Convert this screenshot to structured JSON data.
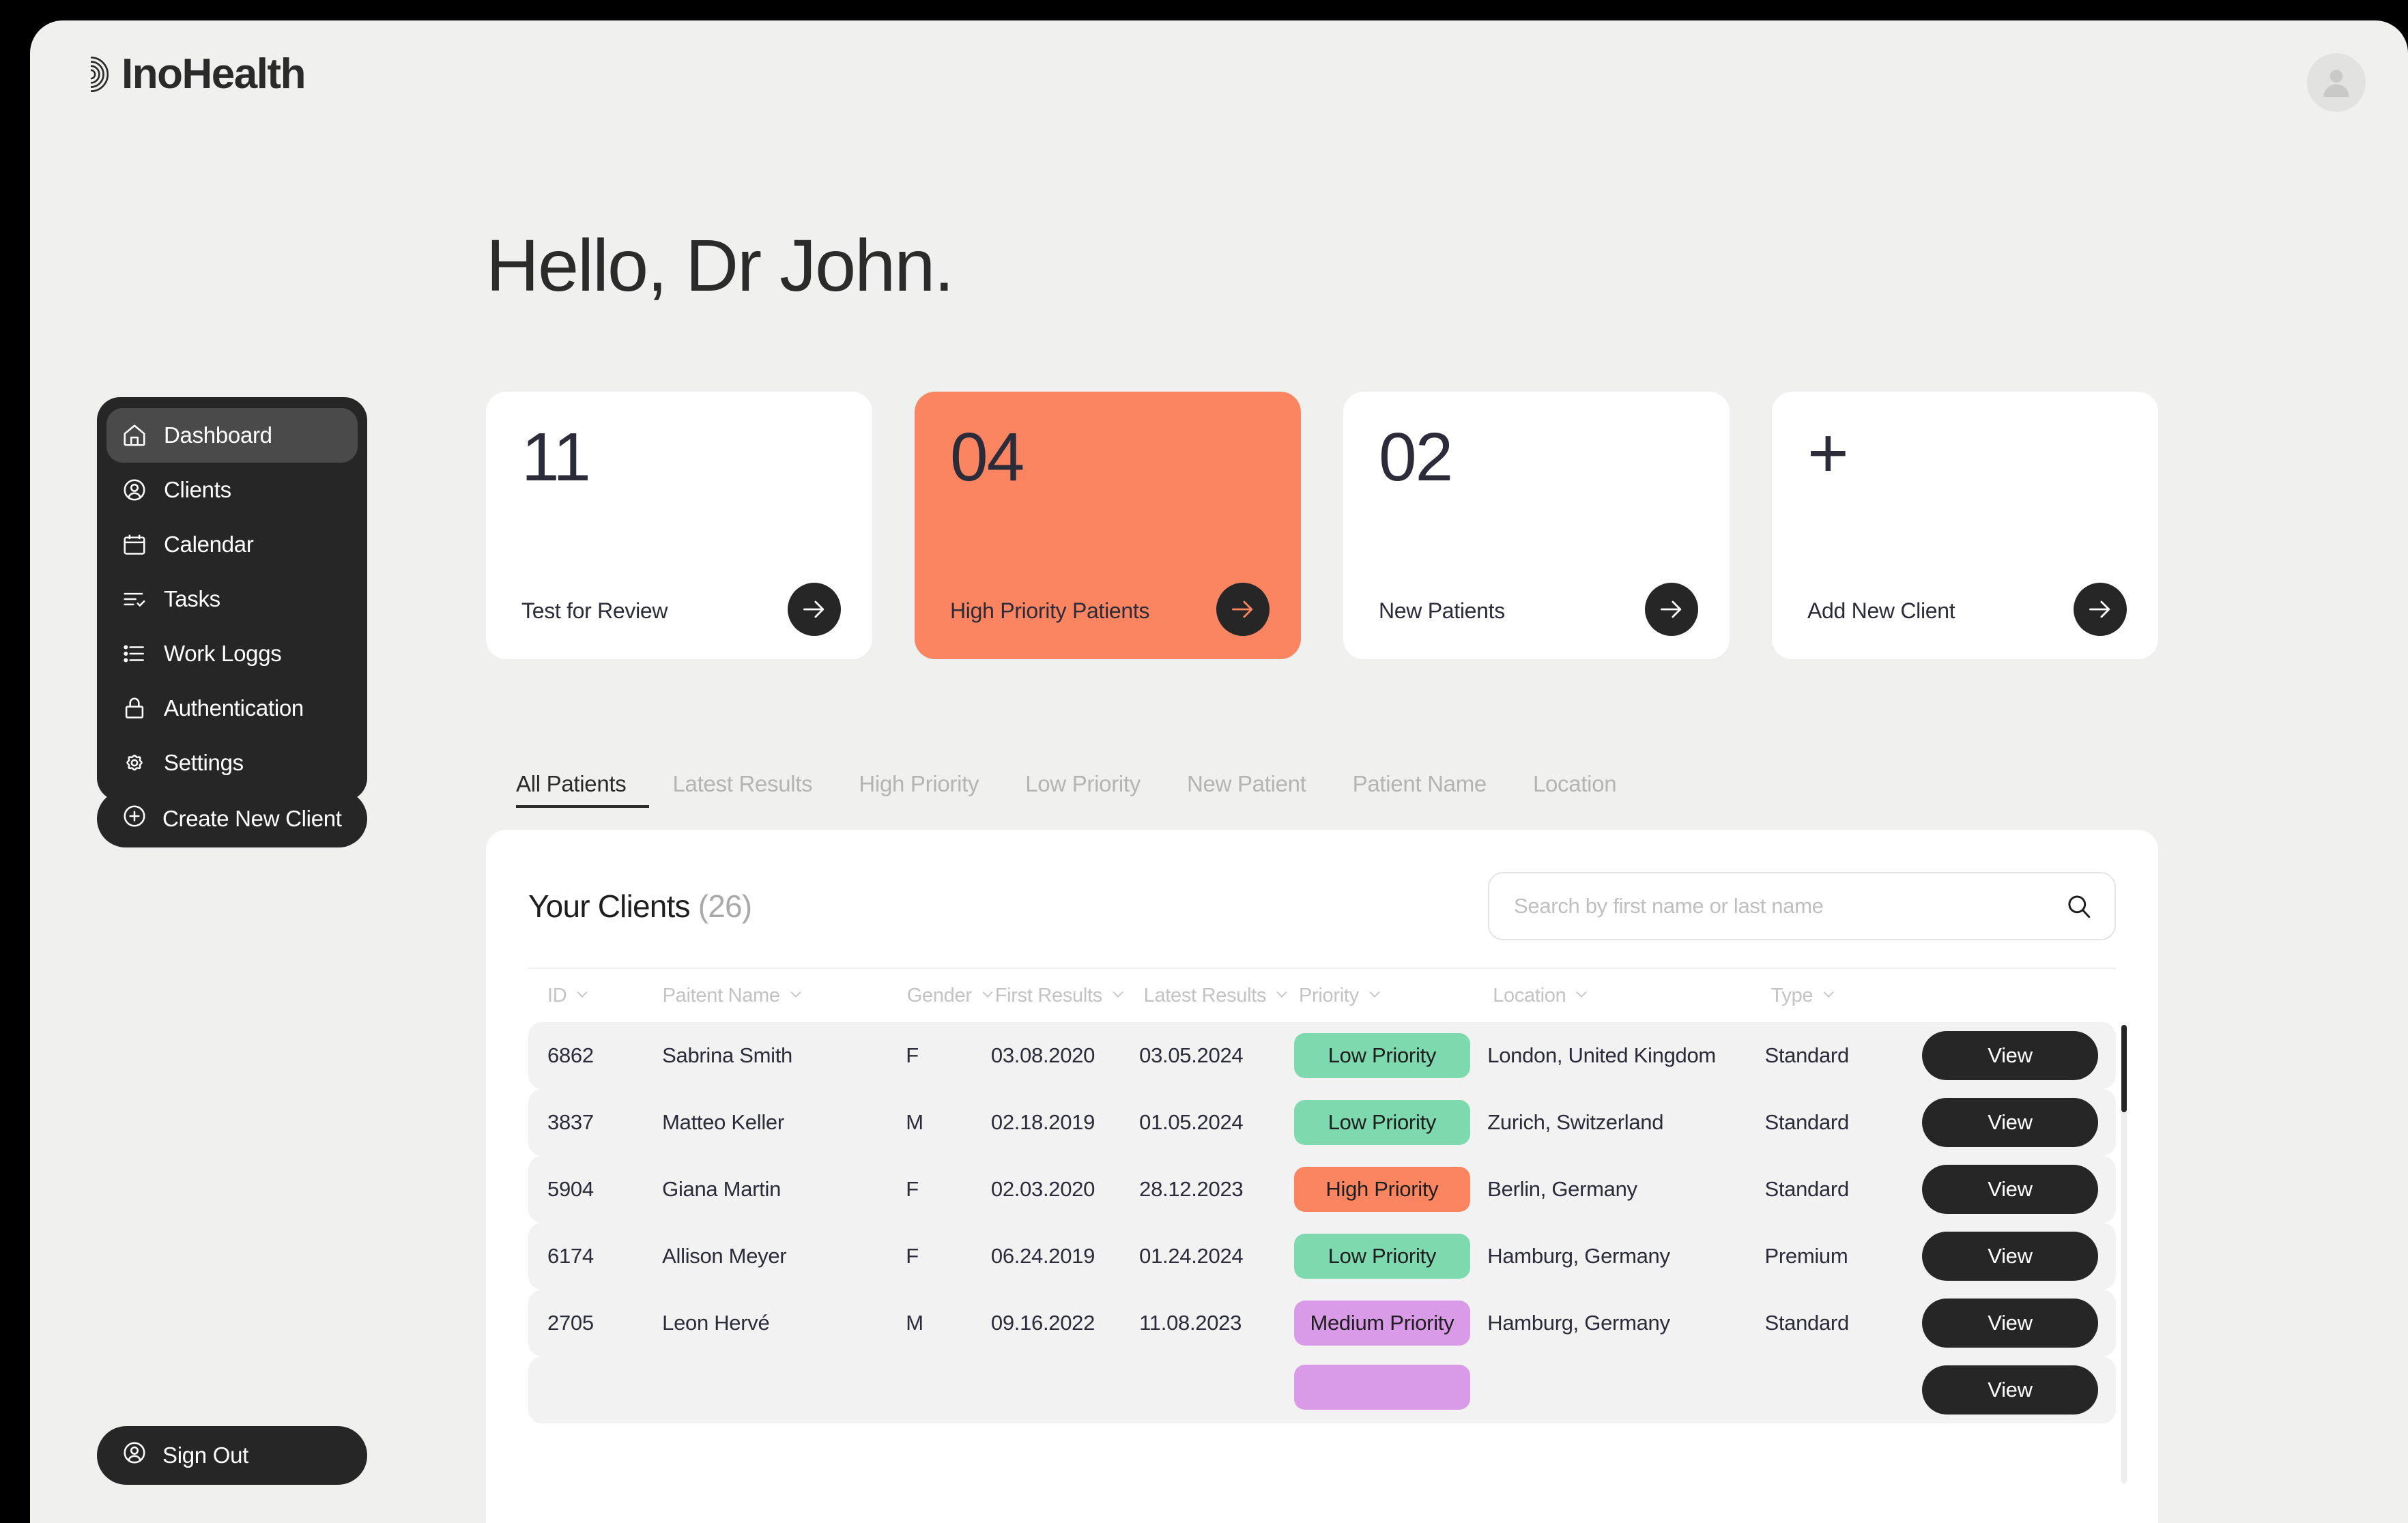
{
  "brand": {
    "name": "InoHealth",
    "logo_icon": "spiral-logo-icon"
  },
  "header": {
    "avatar_icon": "user-avatar-icon"
  },
  "greeting": "Hello, Dr John.",
  "sidebar": {
    "items": [
      {
        "label": "Dashboard",
        "icon": "home-icon",
        "active": true
      },
      {
        "label": "Clients",
        "icon": "user-circle-icon",
        "active": false
      },
      {
        "label": "Calendar",
        "icon": "calendar-icon",
        "active": false
      },
      {
        "label": "Tasks",
        "icon": "list-check-icon",
        "active": false
      },
      {
        "label": "Work Loggs",
        "icon": "list-icon",
        "active": false
      },
      {
        "label": "Authentication",
        "icon": "lock-icon",
        "active": false
      },
      {
        "label": "Settings",
        "icon": "gear-icon",
        "active": false
      }
    ],
    "create_client_label": "Create New Client",
    "create_client_icon": "plus-circle-icon",
    "signout_label": "Sign Out",
    "signout_icon": "user-circle-icon"
  },
  "stat_cards": [
    {
      "value": "11",
      "label": "Test for Review",
      "accent": false,
      "arrow_icon": "arrow-right-icon"
    },
    {
      "value": "04",
      "label": "High Priority Patients",
      "accent": true,
      "arrow_icon": "arrow-right-icon"
    },
    {
      "value": "02",
      "label": "New Patients",
      "accent": false,
      "arrow_icon": "arrow-right-icon"
    },
    {
      "value": "+",
      "label": "Add New Client",
      "accent": false,
      "arrow_icon": "arrow-right-icon"
    }
  ],
  "tabs": [
    {
      "label": "All Patients",
      "active": true
    },
    {
      "label": "Latest Results",
      "active": false
    },
    {
      "label": "High Priority",
      "active": false
    },
    {
      "label": "Low Priority",
      "active": false
    },
    {
      "label": "New Patient",
      "active": false
    },
    {
      "label": "Patient Name",
      "active": false
    },
    {
      "label": "Location",
      "active": false
    }
  ],
  "clients": {
    "title": "Your Clients",
    "count": "(26)",
    "search_placeholder": "Search by first name or last name",
    "search_value": "",
    "search_icon": "search-icon",
    "columns": [
      {
        "label": "ID",
        "sort_icon": "chevron-down-icon"
      },
      {
        "label": "Paitent Name",
        "sort_icon": "chevron-down-icon"
      },
      {
        "label": "Gender",
        "sort_icon": "chevron-down-icon"
      },
      {
        "label": "First Results",
        "sort_icon": "chevron-down-icon"
      },
      {
        "label": "Latest Results",
        "sort_icon": "chevron-down-icon"
      },
      {
        "label": "Priority",
        "sort_icon": "chevron-down-icon"
      },
      {
        "label": "Location",
        "sort_icon": "chevron-down-icon"
      },
      {
        "label": "Type",
        "sort_icon": "chevron-down-icon"
      }
    ],
    "action_label": "View",
    "rows": [
      {
        "id": "6862",
        "name": "Sabrina Smith",
        "gender": "F",
        "first_results": "03.08.2020",
        "latest_results": "03.05.2024",
        "priority": "Low Priority",
        "priority_level": "low",
        "location": "London, United Kingdom",
        "type": "Standard"
      },
      {
        "id": "3837",
        "name": "Matteo Keller",
        "gender": "M",
        "first_results": "02.18.2019",
        "latest_results": "01.05.2024",
        "priority": "Low Priority",
        "priority_level": "low",
        "location": "Zurich, Switzerland",
        "type": "Standard"
      },
      {
        "id": "5904",
        "name": "Giana Martin",
        "gender": "F",
        "first_results": "02.03.2020",
        "latest_results": "28.12.2023",
        "priority": "High Priority",
        "priority_level": "high",
        "location": "Berlin, Germany",
        "type": "Standard"
      },
      {
        "id": "6174",
        "name": "Allison Meyer",
        "gender": "F",
        "first_results": "06.24.2019",
        "latest_results": "01.24.2024",
        "priority": "Low Priority",
        "priority_level": "low",
        "location": "Hamburg, Germany",
        "type": "Premium"
      },
      {
        "id": "2705",
        "name": "Leon Hervé",
        "gender": "M",
        "first_results": "09.16.2022",
        "latest_results": "11.08.2023",
        "priority": "Medium Priority",
        "priority_level": "medium",
        "location": "Hamburg, Germany",
        "type": "Standard"
      },
      {
        "id": "",
        "name": "",
        "gender": "",
        "first_results": "",
        "latest_results": "",
        "priority": "",
        "priority_level": "medium",
        "location": "",
        "type": ""
      }
    ]
  },
  "colors": {
    "accent_orange": "#FA8560",
    "badge_low": "#7FD9AE",
    "badge_high": "#FA8560",
    "badge_medium": "#D99BE8",
    "dark": "#262626",
    "page_bg": "#F0F0EE"
  }
}
